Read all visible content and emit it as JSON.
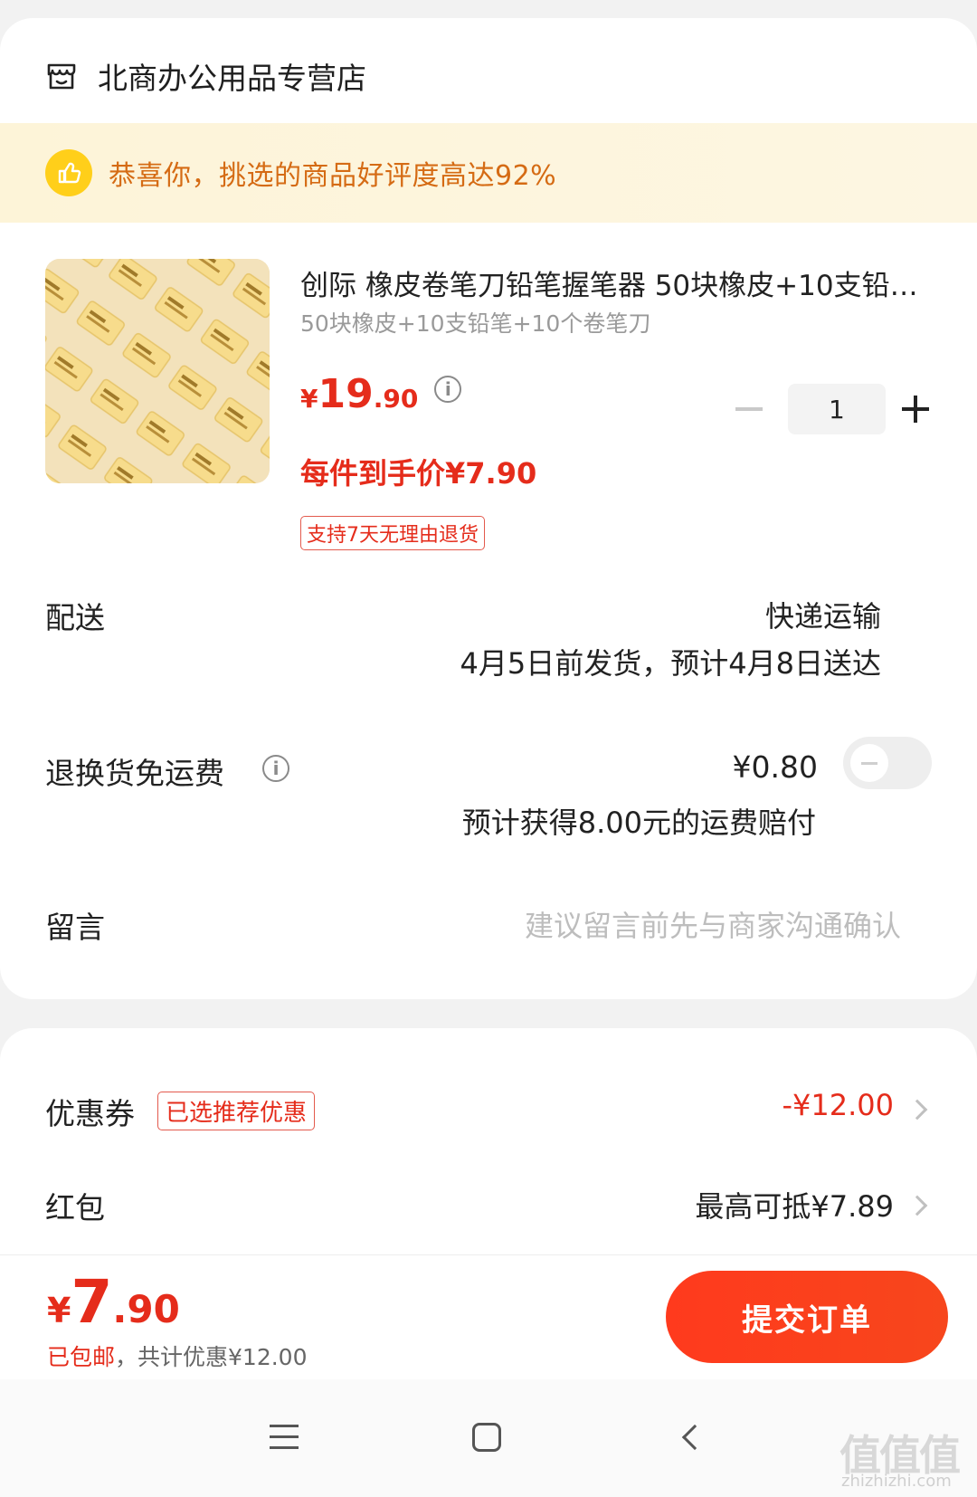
{
  "store": {
    "name": "北商办公用品专营店",
    "icon": "store-icon"
  },
  "congrats": {
    "text": "恭喜你，挑选的商品好评度高达92%",
    "icon": "thumbs-up-icon"
  },
  "product": {
    "title": "创际 橡皮卷笔刀铅笔握笔器 50块橡皮+10支铅笔+10个卷笔刀",
    "sku": "50块橡皮+10支铅笔+10个卷笔刀",
    "price_symbol": "¥",
    "price_int": "19",
    "price_dec": ".90",
    "unit_price": "每件到手价¥7.90",
    "return_tag": "支持7天无理由退货",
    "quantity": "1",
    "image_label": "橡皮"
  },
  "delivery": {
    "label": "配送",
    "type": "快递运输",
    "date": "4月5日前发货，预计4月8日送达"
  },
  "shipping_insurance": {
    "label": "退换货免运费",
    "fee": "¥0.80",
    "compensation": "预计获得8.00元的运费赔付",
    "enabled": false
  },
  "message": {
    "label": "留言",
    "placeholder": "建议留言前先与商家沟通确认"
  },
  "coupon": {
    "label": "优惠券",
    "tag": "已选推荐优惠",
    "amount": "-¥12.00"
  },
  "redpack": {
    "label": "红包",
    "amount": "最高可抵¥7.89"
  },
  "total": {
    "symbol": "¥",
    "int": "7",
    "dec": ".90",
    "note_free_shipping": "已包邮",
    "note_discount": "，共计优惠¥12.00"
  },
  "submit": {
    "label": "提交订单"
  },
  "watermark": {
    "main": "值值值",
    "sub": "zhizhizhi.com"
  },
  "colors": {
    "accent": "#e52c1b",
    "congrats_bg": "#fdf4d8",
    "congrats_text": "#d56b14",
    "badge": "#ffcf1a"
  }
}
